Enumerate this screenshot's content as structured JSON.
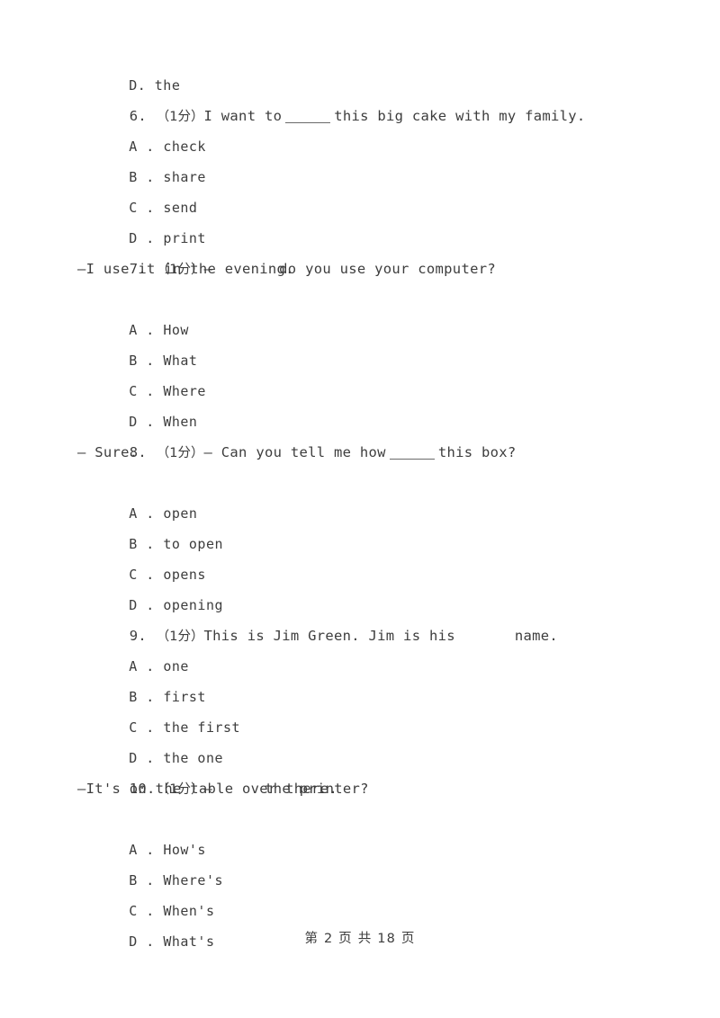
{
  "document": {
    "page_label": "第 2 页 共 18 页",
    "text_color": "#3d3d3d",
    "background_color": "#ffffff"
  },
  "orphan_option": {
    "letter": "D",
    "separator": ".",
    "text": "the"
  },
  "questions": [
    {
      "number": "6.",
      "marks": "（1分）",
      "stem_before": "I want to",
      "blank_type": "underline",
      "stem_after": "this big cake with my family.",
      "answer_line": "",
      "options": [
        {
          "letter": "A",
          "separator": ".",
          "text": "check"
        },
        {
          "letter": "B",
          "separator": ".",
          "text": "share"
        },
        {
          "letter": "C",
          "separator": ".",
          "text": "send"
        },
        {
          "letter": "D",
          "separator": ".",
          "text": "print"
        }
      ]
    },
    {
      "number": "7.",
      "marks": "（1分）",
      "stem_before": "—",
      "blank_type": "space",
      "stem_after": "do you use your computer?",
      "answer_line": "—I use it in the evening.",
      "options": [
        {
          "letter": "A",
          "separator": ".",
          "text": "How"
        },
        {
          "letter": "B",
          "separator": ".",
          "text": "What"
        },
        {
          "letter": "C",
          "separator": ".",
          "text": "Where"
        },
        {
          "letter": "D",
          "separator": ".",
          "text": "When"
        }
      ]
    },
    {
      "number": "8.",
      "marks": "（1分）",
      "stem_before": "— Can you tell me how",
      "blank_type": "underline",
      "stem_after": "this box?",
      "answer_line": "— Sure.",
      "options": [
        {
          "letter": "A",
          "separator": ".",
          "text": "open"
        },
        {
          "letter": "B",
          "separator": ".",
          "text": "to open"
        },
        {
          "letter": "C",
          "separator": ".",
          "text": "opens"
        },
        {
          "letter": "D",
          "separator": ".",
          "text": "opening"
        }
      ]
    },
    {
      "number": "9.",
      "marks": "（1分）",
      "stem_before": "This is Jim Green. Jim is his",
      "blank_type": "space",
      "stem_after": "name.",
      "answer_line": "",
      "options": [
        {
          "letter": "A",
          "separator": ".",
          "text": "one"
        },
        {
          "letter": "B",
          "separator": ".",
          "text": "first"
        },
        {
          "letter": "C",
          "separator": ".",
          "text": "the first"
        },
        {
          "letter": "D",
          "separator": ".",
          "text": "the one"
        }
      ]
    },
    {
      "number": "10.",
      "marks": "（1分）",
      "stem_before": "—",
      "blank_type": "space",
      "stem_after": "the printer?",
      "answer_line": "—It's on the table over there.",
      "options": [
        {
          "letter": "A",
          "separator": ".",
          "text": "How's"
        },
        {
          "letter": "B",
          "separator": ".",
          "text": "Where's"
        },
        {
          "letter": "C",
          "separator": ".",
          "text": "When's"
        },
        {
          "letter": "D",
          "separator": ".",
          "text": "What's"
        }
      ]
    }
  ]
}
